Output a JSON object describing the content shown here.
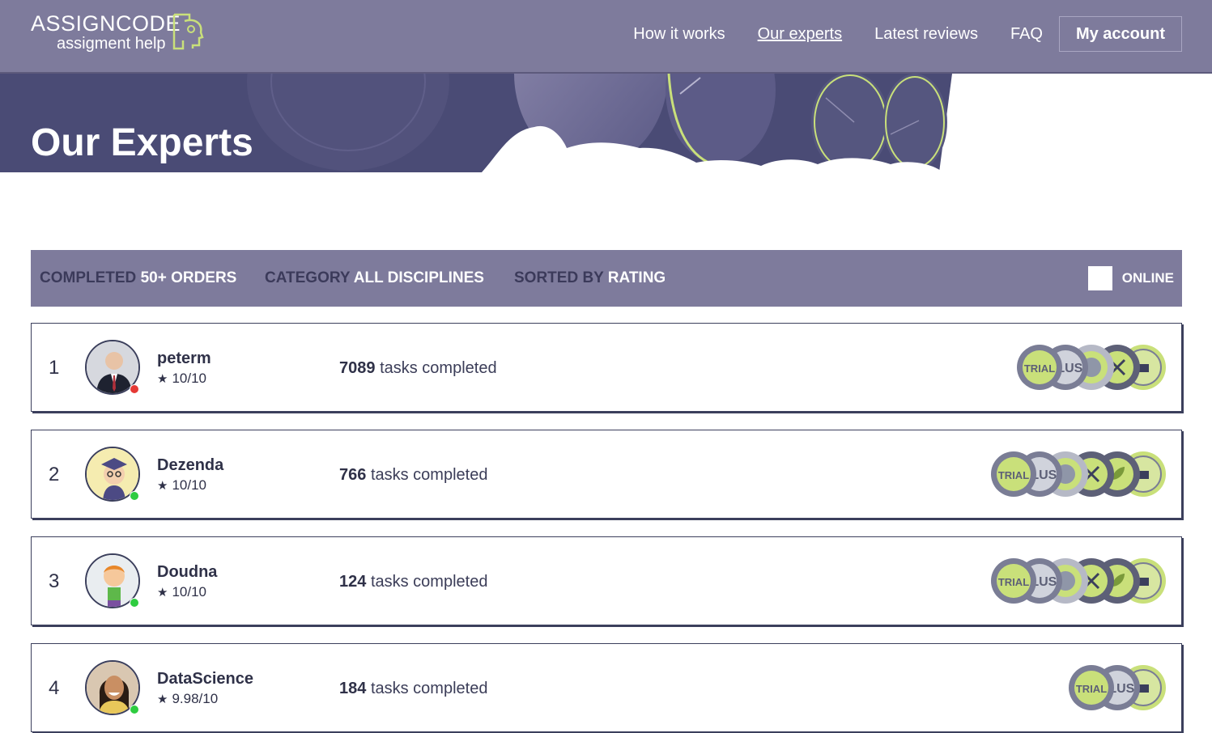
{
  "header": {
    "logo_title": "ASSIGNCODE",
    "logo_subtitle": "assigment help",
    "nav": [
      {
        "label": "How it works",
        "active": false
      },
      {
        "label": "Our experts",
        "active": true
      },
      {
        "label": "Latest reviews",
        "active": false
      },
      {
        "label": "FAQ",
        "active": false
      }
    ],
    "account_label": "My account"
  },
  "hero": {
    "title": "Our Experts"
  },
  "filters": {
    "completed_key": "COMPLETED",
    "completed_value": "50+ ORDERS",
    "category_key": "CATEGORY",
    "category_value": "ALL DISCIPLINES",
    "sorted_key": "SORTED BY",
    "sorted_value": "RATING",
    "online_label": "ONLINE"
  },
  "experts": [
    {
      "rank": "1",
      "name": "peterm",
      "rating": "10/10",
      "tasks_count": "7089",
      "tasks_label": "tasks completed",
      "status": "offline",
      "badges": 5
    },
    {
      "rank": "2",
      "name": "Dezenda",
      "rating": "10/10",
      "tasks_count": "766",
      "tasks_label": "tasks completed",
      "status": "online",
      "badges": 6
    },
    {
      "rank": "3",
      "name": "Doudna",
      "rating": "10/10",
      "tasks_count": "124",
      "tasks_label": "tasks completed",
      "status": "online",
      "badges": 6
    },
    {
      "rank": "4",
      "name": "DataScience",
      "rating": "9.98/10",
      "tasks_count": "184",
      "tasks_label": "tasks completed",
      "status": "online",
      "badges": 3
    }
  ],
  "icons": {
    "star": "star-icon",
    "checkbox": "checkbox-icon"
  },
  "colors": {
    "header_bg": "#7e7b9c",
    "hero_bg": "#4a4b75",
    "accent_green": "#c9e07a",
    "online": "#2ecc40",
    "offline": "#e53935",
    "border": "#3b3f5c"
  }
}
